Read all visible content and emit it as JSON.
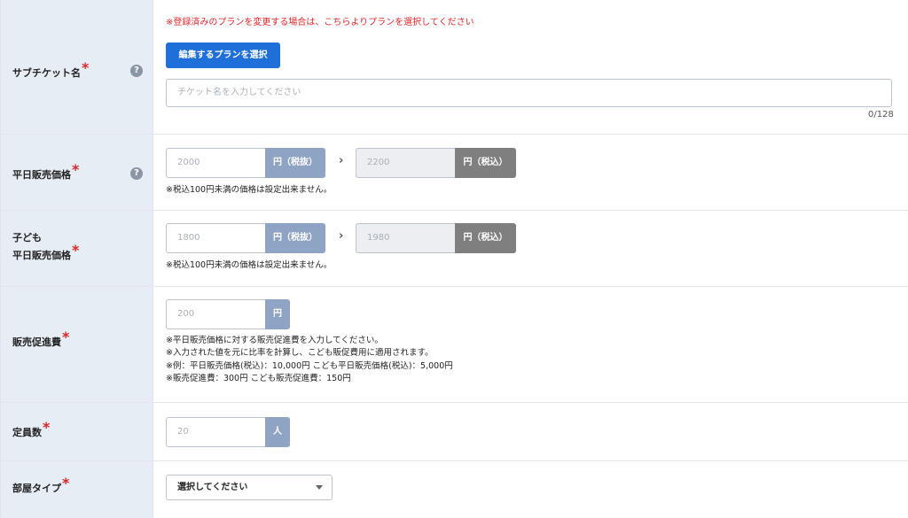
{
  "subticket": {
    "label": "サブチケット名",
    "notice": "※登録済みのプランを変更する場合は、こちらよりプランを選択してください",
    "button": "編集するプランを選択",
    "placeholder": "チケット名を入力してください",
    "counter": "0/128"
  },
  "weekday_price": {
    "label": "平日販売価格",
    "value": "2000",
    "unit_excl": "円（税抜）",
    "arrow": "›",
    "incl_value": "2200",
    "unit_incl": "円（税込）",
    "note": "※税込100円未満の価格は設定出来ません。"
  },
  "child_price": {
    "label_line1": "子ども",
    "label_line2": "平日販売価格",
    "value": "1800",
    "unit_excl": "円（税抜）",
    "arrow": "›",
    "incl_value": "1980",
    "unit_incl": "円（税込）",
    "note": "※税込100円未満の価格は設定出来ません。"
  },
  "promo_fee": {
    "label": "販売促進費",
    "value": "200",
    "unit": "円",
    "notes": [
      "※平日販売価格に対する販売促進費を入力してください。",
      "※入力された値を元に比率を計算し、こども販促費用に適用されます。",
      "※例：平日販売価格(税込)：10,000円 こども平日販売価格(税込)：5,000円",
      "※販売促進費：300円 こども販売促進費：150円"
    ]
  },
  "capacity": {
    "label": "定員数",
    "value": "20",
    "unit": "人"
  },
  "room_type": {
    "label": "部屋タイプ",
    "selected": "選択してください"
  },
  "required_mark": "*",
  "help_mark": "?"
}
